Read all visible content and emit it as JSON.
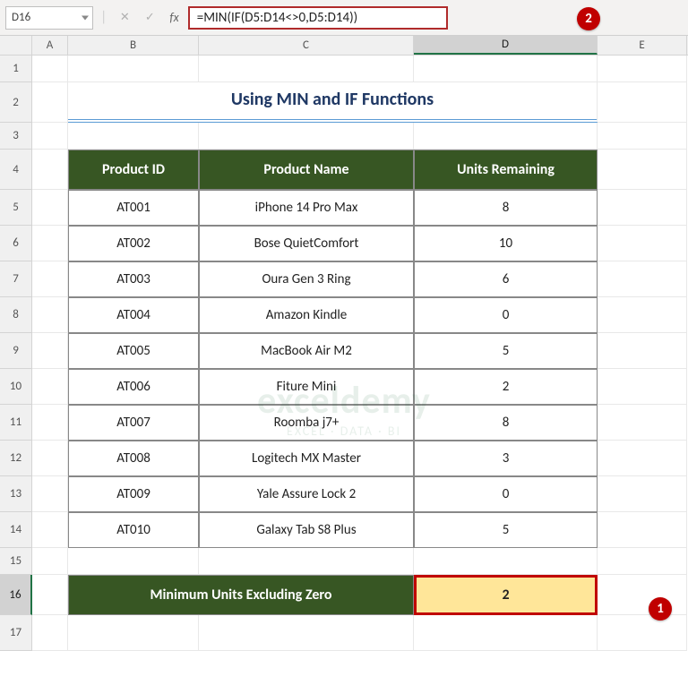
{
  "name_box": "D16",
  "formula": "=MIN(IF(D5:D14<>0,D5:D14))",
  "fx_label": "fx",
  "columns": [
    "A",
    "B",
    "C",
    "D",
    "E"
  ],
  "rows": [
    "1",
    "2",
    "3",
    "4",
    "5",
    "6",
    "7",
    "8",
    "9",
    "10",
    "11",
    "12",
    "13",
    "14",
    "15",
    "16",
    "17"
  ],
  "title": "Using MIN and IF Functions",
  "headers": {
    "product_id": "Product ID",
    "product_name": "Product Name",
    "units_remaining": "Units Remaining"
  },
  "data": [
    {
      "id": "AT001",
      "name": "iPhone 14 Pro Max",
      "units": "8"
    },
    {
      "id": "AT002",
      "name": "Bose QuietComfort",
      "units": "10"
    },
    {
      "id": "AT003",
      "name": "Oura Gen 3 Ring",
      "units": "6"
    },
    {
      "id": "AT004",
      "name": "Amazon Kindle",
      "units": "0"
    },
    {
      "id": "AT005",
      "name": "MacBook Air M2",
      "units": "5"
    },
    {
      "id": "AT006",
      "name": "Fiture Mini",
      "units": "2"
    },
    {
      "id": "AT007",
      "name": "Roomba j7+",
      "units": "8"
    },
    {
      "id": "AT008",
      "name": "Logitech MX Master",
      "units": "3"
    },
    {
      "id": "AT009",
      "name": "Yale Assure Lock 2",
      "units": "0"
    },
    {
      "id": "AT010",
      "name": "Galaxy Tab S8 Plus",
      "units": "5"
    }
  ],
  "summary": {
    "label": "Minimum Units Excluding Zero",
    "value": "2"
  },
  "callouts": {
    "one": "1",
    "two": "2"
  },
  "watermark": {
    "main": "exceldemy",
    "sub": "EXCEL · DATA · BI"
  },
  "active_cell": {
    "row": "16",
    "col": "D"
  }
}
